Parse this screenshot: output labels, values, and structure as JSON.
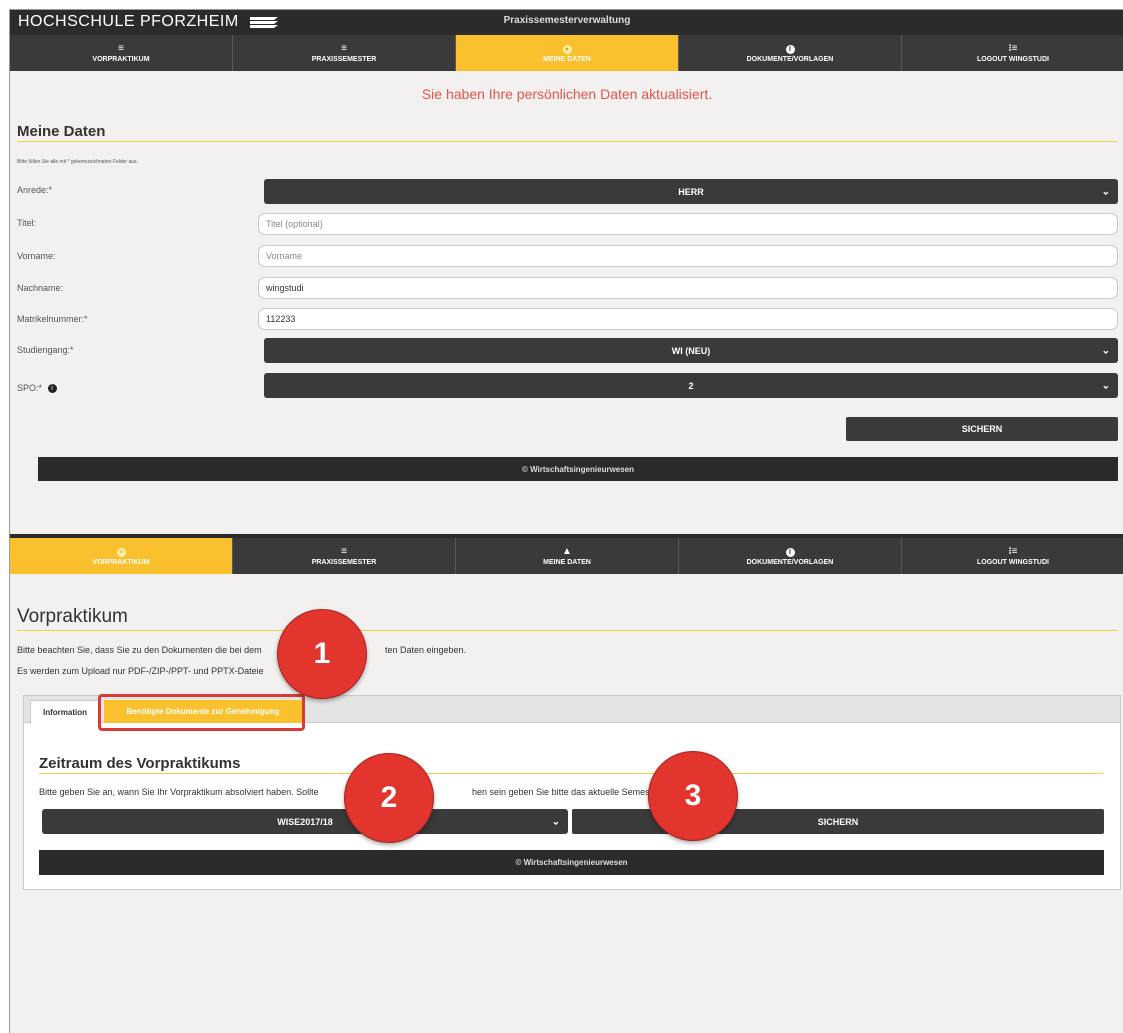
{
  "header": {
    "logo": "HOCHSCHULE PFORZHEIM",
    "app_title": "Praxissemesterverwaltung"
  },
  "nav": [
    {
      "label": "VORPRAKTIKUM",
      "icon": "menu-icon"
    },
    {
      "label": "PRAXISSEMESTER",
      "icon": "menu-icon"
    },
    {
      "label": "MEINE DATEN",
      "icon": "user-icon"
    },
    {
      "label": "DOKUMENTE/VORLAGEN",
      "icon": "info-icon"
    },
    {
      "label": "LOGOUT WINGSTUDI",
      "icon": "list-icon"
    }
  ],
  "meine_daten": {
    "success_message": "Sie haben Ihre persönlichen Daten aktualisiert.",
    "title": "Meine Daten",
    "hint": "Bitte füllen Sie alle mit * gekennzeichneten Felder aus.",
    "anrede": {
      "label": "Anrede:*",
      "value": "HERR"
    },
    "titel": {
      "label": "Titel:",
      "placeholder": "Titel (optional)",
      "value": ""
    },
    "vorname": {
      "label": "Vorname:",
      "placeholder": "Vorname",
      "value": ""
    },
    "nachname": {
      "label": "Nachname:",
      "value": "wingstudi"
    },
    "matrikel": {
      "label": "Matrikelnummer:*",
      "value": "112233"
    },
    "studiengang": {
      "label": "Studiengang:*",
      "value": "WI (NEU)"
    },
    "spo": {
      "label": "SPO:*",
      "value": "2"
    },
    "save_label": "SICHERN",
    "footer": "© Wirtschaftsingenieurwesen"
  },
  "vorpraktikum": {
    "title": "Vorpraktikum",
    "line1_start": "Bitte beachten Sie, dass Sie zu den Dokumenten die bei dem",
    "line1_end": "ten Daten eingeben.",
    "line2": "Es werden zum Upload nur PDF-/ZIP-/PPT- und PPTX-Dateie",
    "tabs": {
      "info": "Information",
      "required": "Benötigte Dokumente zur Genehmigung"
    },
    "section_title": "Zeitraum des Vorpraktikums",
    "section_text_start": "Bitte geben Sie an, wann Sie Ihr Vorpraktikum absolviert haben. Sollte",
    "section_text_end": "hen sein geben Sie bitte das aktuelle Semeste",
    "semester_value": "WISE2017/18",
    "save_label": "SICHERN",
    "footer": "© Wirtschaftsingenieurwesen"
  },
  "markers": [
    "1",
    "2",
    "3"
  ],
  "colors": {
    "accent": "#fbc02d",
    "dark": "#3a3a3a",
    "alert": "#e0554d",
    "marker": "#e2352e"
  }
}
